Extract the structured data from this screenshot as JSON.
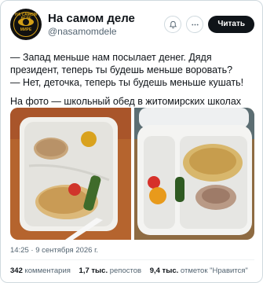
{
  "account": {
    "display_name": "На самом деле",
    "handle": "@nasamomdele",
    "avatar_text_top": "НА САМОМ ДЕЛЕ",
    "avatar_text_bottom": "МИРЕ"
  },
  "header": {
    "follow_label": "Читать",
    "notify_icon": "bell-plus-icon",
    "more_icon": "more-dots-icon"
  },
  "tweet": {
    "line1": "— Запад меньше нам посылает денег. Дядя президент, теперь ты будешь меньше воровать?",
    "line2": "— Нет, деточка, теперь ты будешь меньше кушать!",
    "line3": "На фото — школьный обед в житомирских школах"
  },
  "meta": {
    "timestamp": "14:25 · 9 сентября 2026 г."
  },
  "stats": {
    "comments_value": "342",
    "comments_label": "комментария",
    "reposts_value": "1,7 тыс.",
    "reposts_label": "репостов",
    "likes_value": "9,4 тыс.",
    "likes_label": "отметок \"Нравится\""
  },
  "colors": {
    "accent": "#0f1419",
    "secondary_text": "#536471",
    "border": "#cfd9de",
    "brand_gold": "#d4a017"
  }
}
